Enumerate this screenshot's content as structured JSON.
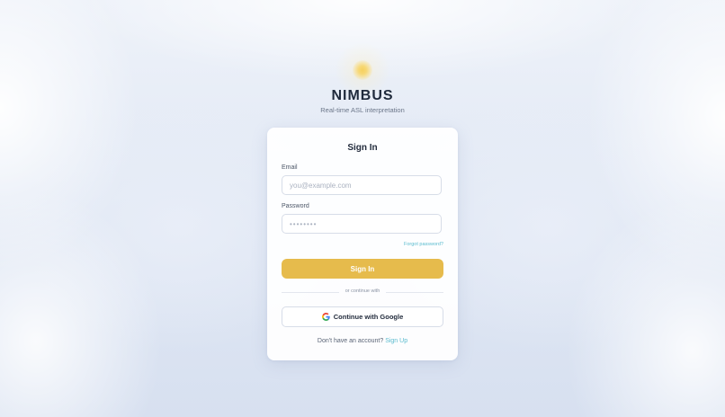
{
  "brand": {
    "name": "NIMBUS",
    "tagline": "Real-time ASL interpretation",
    "logo_icon": "sun-icon",
    "logo_color": "#f1c232"
  },
  "form": {
    "title": "Sign In",
    "email_label": "Email",
    "email_placeholder": "you@example.com",
    "email_value": "",
    "password_label": "Password",
    "password_placeholder": "••••••••",
    "password_value": "",
    "forgot_label": "Forgot password?",
    "submit_label": "Sign In",
    "divider_text": "or continue with",
    "google_label": "Continue with Google",
    "google_icon": "google-icon",
    "signup_prompt": "Don't have an account?",
    "signup_link": "Sign Up"
  },
  "colors": {
    "accent": "#e6bb4c",
    "link": "#5cbccf",
    "text": "#232c3d"
  }
}
